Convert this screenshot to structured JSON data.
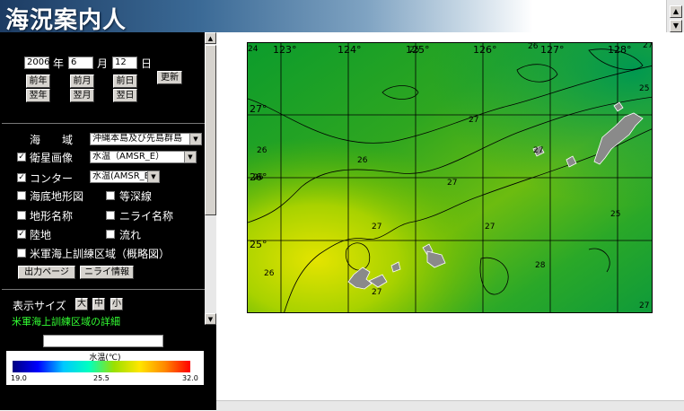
{
  "header": {
    "title": "海況案内人"
  },
  "date": {
    "year": "2006",
    "year_unit": "年",
    "month": "6",
    "month_unit": "月",
    "day": "12",
    "day_unit": "日"
  },
  "nav": {
    "prev_year": "前年",
    "prev_month": "前月",
    "prev_day": "前日",
    "next_year": "翌年",
    "next_month": "翌月",
    "next_day": "翌日",
    "update": "更新"
  },
  "sea_area": {
    "label": "海　　域",
    "value": "沖縄本島及び先島群島"
  },
  "satellite": {
    "label": "衛星画像",
    "value": "水温（AMSR_E）",
    "checked": true
  },
  "contour": {
    "label": "コンター",
    "value": "水温(AMSR_E)",
    "checked": true
  },
  "layers": {
    "seafloor": "海底地形図",
    "isobath": "等深線",
    "place_names": "地形名称",
    "nirai_names": "ニライ名称",
    "land": "陸地",
    "current": "流れ",
    "training_area": "米軍海上訓練区域（概略図）"
  },
  "buttons": {
    "output_page": "出力ページ",
    "nirai_info": "ニライ情報"
  },
  "display_size": {
    "label": "表示サイズ",
    "large": "大",
    "medium": "中",
    "small": "小"
  },
  "link": {
    "training_detail": "米軍海上訓練区域の詳細"
  },
  "legend": {
    "title": "水温(℃)",
    "min": "19.0",
    "mid": "25.5",
    "max": "32.0",
    "colors": [
      "#00007f",
      "#0000ff",
      "#00c8ff",
      "#00ffc0",
      "#9be000",
      "#ffe600",
      "#ff8800",
      "#ff0000"
    ]
  },
  "map": {
    "lon_labels": [
      "123°",
      "124°",
      "125°",
      "126°",
      "127°",
      "128°"
    ],
    "lat_labels": [
      "27°",
      "26°",
      "25°"
    ],
    "contours": [
      "24",
      "25",
      "26",
      "27",
      "25",
      "26",
      "27",
      "27",
      "26",
      "27",
      "25",
      "26",
      "27",
      "27",
      "28",
      "27",
      "27",
      "26"
    ]
  }
}
